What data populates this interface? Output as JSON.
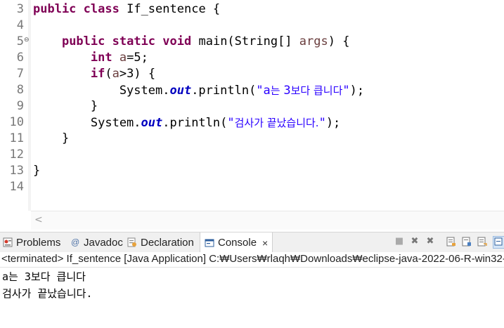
{
  "editor": {
    "lines": [
      {
        "num": "3",
        "segs": [
          {
            "t": "public",
            "c": "kw"
          },
          {
            "t": " "
          },
          {
            "t": "class",
            "c": "kw"
          },
          {
            "t": " If_sentence {"
          }
        ]
      },
      {
        "num": "4",
        "segs": []
      },
      {
        "num": "5",
        "segs": [
          {
            "t": "    "
          },
          {
            "t": "public",
            "c": "kw"
          },
          {
            "t": " "
          },
          {
            "t": "static",
            "c": "kw"
          },
          {
            "t": " "
          },
          {
            "t": "void",
            "c": "kw"
          },
          {
            "t": " main(String[] "
          },
          {
            "t": "args",
            "c": "var"
          },
          {
            "t": ") {"
          }
        ]
      },
      {
        "num": "6",
        "segs": [
          {
            "t": "        "
          },
          {
            "t": "int",
            "c": "kw"
          },
          {
            "t": " "
          },
          {
            "t": "a",
            "c": "var"
          },
          {
            "t": "=5;"
          }
        ]
      },
      {
        "num": "7",
        "segs": [
          {
            "t": "        "
          },
          {
            "t": "if",
            "c": "kw"
          },
          {
            "t": "("
          },
          {
            "t": "a",
            "c": "var"
          },
          {
            "t": ">3) {"
          }
        ]
      },
      {
        "num": "8",
        "segs": [
          {
            "t": "            System."
          },
          {
            "t": "out",
            "c": "st"
          },
          {
            "t": ".println("
          },
          {
            "t": "\"a",
            "c": "str"
          },
          {
            "t": "는 ",
            "c": "str ko"
          },
          {
            "t": "3",
            "c": "str"
          },
          {
            "t": "보다 큽니다",
            "c": "str ko"
          },
          {
            "t": "\"",
            "c": "str"
          },
          {
            "t": ");"
          }
        ]
      },
      {
        "num": "9",
        "segs": [
          {
            "t": "        }"
          }
        ]
      },
      {
        "num": "10",
        "segs": [
          {
            "t": "        System."
          },
          {
            "t": "out",
            "c": "st"
          },
          {
            "t": ".println("
          },
          {
            "t": "\"",
            "c": "str"
          },
          {
            "t": "검사가 끝났습니다.",
            "c": "str ko"
          },
          {
            "t": "\"",
            "c": "str"
          },
          {
            "t": ");"
          }
        ]
      },
      {
        "num": "11",
        "segs": [
          {
            "t": "    }"
          }
        ]
      },
      {
        "num": "12",
        "segs": []
      },
      {
        "num": "13",
        "segs": [
          {
            "t": "}"
          }
        ]
      },
      {
        "num": "14",
        "segs": []
      }
    ],
    "fold_marker": "⊖",
    "scroll_left_arrow": "<"
  },
  "tabs": {
    "problems": {
      "label": "Problems",
      "icon": "problems-icon"
    },
    "javadoc": {
      "label": "Javadoc",
      "icon": "at-icon"
    },
    "declaration": {
      "label": "Declaration",
      "icon": "declaration-icon"
    },
    "console": {
      "label": "Console",
      "icon": "console-icon",
      "close": "×"
    }
  },
  "console": {
    "status": "<terminated> If_sentence [Java Application] C:₩Users₩rlaqh₩Downloads₩eclipse-java-2022-06-R-win32-",
    "output": [
      "a는 3보다 큽니다",
      "검사가 끝났습니다."
    ]
  },
  "colors": {
    "keyword": "#7f0055",
    "string": "#2a00ff",
    "static_field": "#0000c0",
    "local_var": "#6a3e3e",
    "line_number": "#787878"
  }
}
